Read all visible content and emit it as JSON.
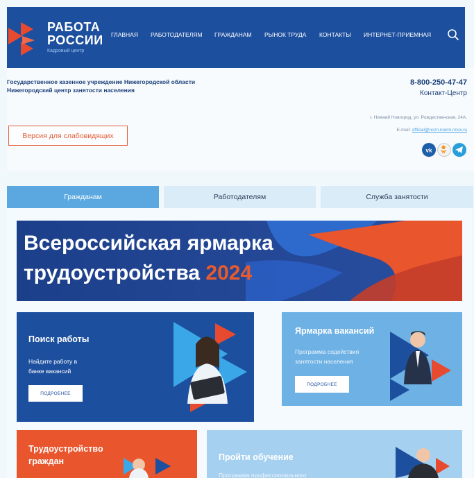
{
  "header": {
    "brand_line1": "РАБОТА",
    "brand_line2": "РОССИИ",
    "brand_sub": "Кадровый центр",
    "nav": [
      {
        "label": "ГЛАВНАЯ"
      },
      {
        "label": "РАБОТОДАТЕЛЯМ"
      },
      {
        "label": "ГРАЖДАНАМ"
      },
      {
        "label": "РЫНОК ТРУДА"
      },
      {
        "label": "КОНТАКТЫ"
      },
      {
        "label": "ИНТЕРНЕТ-ПРИЕМНАЯ"
      }
    ],
    "colors": {
      "bg": "#1d4f9f",
      "logo_red": "#e84a2f"
    }
  },
  "info": {
    "org_line1": "Государственное казенное учреждение Нижегородской области",
    "org_line2": "Нижегородский центр занятости населения",
    "phone": "8-800-250-47-47",
    "phone_label": "Контакт-Центр",
    "address": "г. Нижний Новгород, ул. Рождественская, 24А.",
    "email_label": "E-mail:",
    "email": "official@nczn.kreml.nnov.ru",
    "vision_button": "Версия для слабовидящих",
    "social": [
      {
        "icon": "vk-icon",
        "color": "#1d5fa8"
      },
      {
        "icon": "ok-icon",
        "color": "#f2f2f2"
      },
      {
        "icon": "telegram-icon",
        "color": "#2a9ddb"
      }
    ]
  },
  "tabs": [
    {
      "label": "Гражданам",
      "active": true
    },
    {
      "label": "Работодателям",
      "active": false
    },
    {
      "label": "Служба занятости",
      "active": false
    }
  ],
  "banner": {
    "line1": "Всероссийская ярмарка",
    "line2": "трудоустройства",
    "year": "2024"
  },
  "cards": {
    "job_search": {
      "title": "Поиск работы",
      "text_line1": "Найдите работу в",
      "text_line2": "банке вакансий",
      "button": "ПОДРОБНЕЕ"
    },
    "job_fair": {
      "title": "Ярмарка вакансий",
      "text_line1": "Программа содействия",
      "text_line2": "занятости населения",
      "button": "ПОДРОБНЕЕ"
    },
    "employment": {
      "title_line1": "Трудоустройство",
      "title_line2": "граждан"
    },
    "training": {
      "title": "Пройти обучение",
      "text_line1": "Программа профессионального"
    }
  }
}
